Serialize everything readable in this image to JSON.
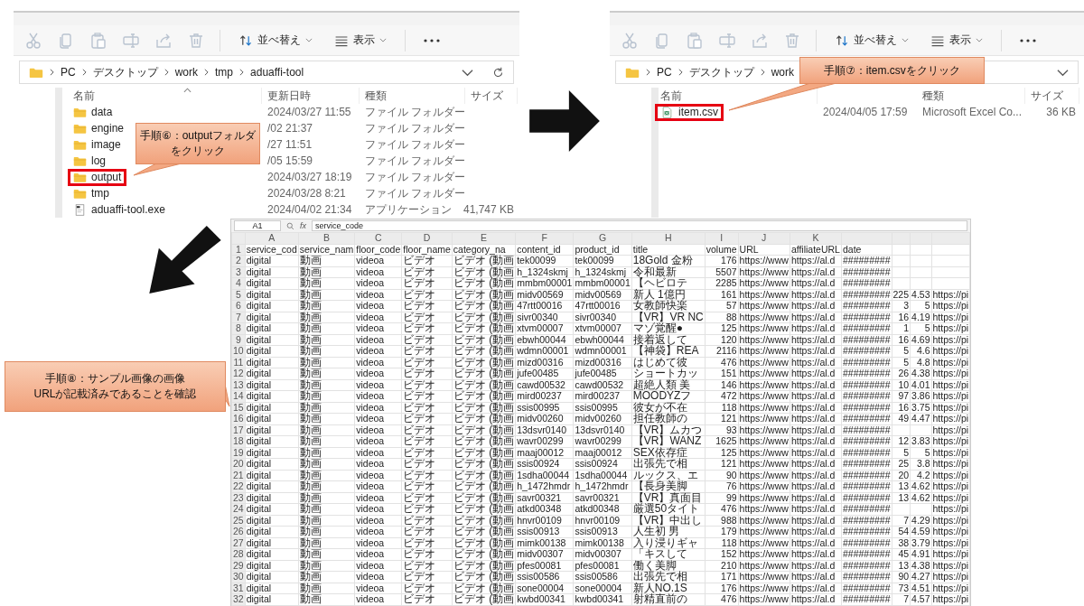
{
  "explorers": [
    {
      "toolbar": {
        "sort": "並べ替え",
        "view": "表示"
      },
      "address": {
        "path": [
          "PC",
          "デスクトップ",
          "work",
          "tmp",
          "aduaffi-tool"
        ],
        "controls": [
          {
            "kind": "dropdown"
          },
          {
            "kind": "refresh"
          }
        ]
      },
      "columns": [
        {
          "kind": "name",
          "label": "名前",
          "sorted": true
        },
        {
          "kind": "modified",
          "label": "更新日時",
          "sorted": false
        },
        {
          "kind": "type",
          "label": "種類",
          "sorted": false
        },
        {
          "kind": "size",
          "label": "サイズ",
          "sorted": false
        }
      ],
      "files": [
        {
          "kind": "folder",
          "name": "data",
          "modified": "2024/03/27 11:55",
          "type": "ファイル フォルダー",
          "highlighted": false
        },
        {
          "kind": "folder",
          "name": "engine",
          "modified": "/02 21:37",
          "type": "ファイル フォルダー",
          "highlighted": false
        },
        {
          "kind": "folder",
          "name": "image",
          "modified": "/27 11:51",
          "type": "ファイル フォルダー",
          "highlighted": false
        },
        {
          "kind": "folder",
          "name": "log",
          "modified": "/05 15:59",
          "type": "ファイル フォルダー",
          "highlighted": false
        },
        {
          "kind": "folder",
          "name": "output",
          "modified": "2024/03/27 18:19",
          "type": "ファイル フォルダー",
          "highlighted": true
        },
        {
          "kind": "folder",
          "name": "tmp",
          "modified": "2024/03/28 8:21",
          "type": "ファイル フォルダー",
          "highlighted": false
        },
        {
          "kind": "app",
          "name": "aduaffi-tool.exe",
          "modified": "2024/04/02 21:34",
          "type": "アプリケーション",
          "size": "41,747 KB",
          "highlighted": false
        }
      ]
    },
    {
      "toolbar": {
        "sort": "並べ替え",
        "view": "表示"
      },
      "address": {
        "path": [
          "PC",
          "デスクトップ",
          "work"
        ],
        "controls": [
          {
            "kind": "dropdown"
          }
        ]
      },
      "columns": [
        {
          "kind": "name",
          "label": "名前",
          "sorted": false
        },
        {
          "kind": "type",
          "label": "種類",
          "sorted": false
        },
        {
          "kind": "size",
          "label": "サイズ",
          "sorted": false
        }
      ],
      "files": [
        {
          "kind": "csv",
          "name": "item.csv",
          "modified": "2024/04/05 17:59",
          "type": "Microsoft Excel Co...",
          "size": "36 KB",
          "highlighted": true
        }
      ]
    }
  ],
  "callouts": [
    {
      "lines": [
        "手順⑥：outputフォルダ",
        "をクリック"
      ]
    },
    {
      "lines": [
        "手順⑦：item.csvをクリック"
      ]
    },
    {
      "lines": [
        "手順⑧：サンプル画像の画像",
        "URLが記載済みであることを確認"
      ]
    }
  ],
  "spreadsheet": {
    "name_box": "A1",
    "fx": "fx",
    "formula": "service_code",
    "column_letters": [
      "A",
      "B",
      "C",
      "D",
      "E",
      "F",
      "G",
      "H",
      "I",
      "J",
      "K"
    ],
    "rows": [
      {
        "number": "1",
        "cells": [
          "service_cod",
          "service_nam",
          "floor_code",
          "floor_name",
          "category_na",
          "content_id",
          "product_id",
          "title",
          "volume",
          "URL",
          "affiliateURL",
          "date",
          null,
          null,
          null
        ]
      },
      {
        "number": "2",
        "cells": [
          "digital",
          "動画",
          "videoa",
          "ビデオ",
          "ビデオ (動画",
          "tek00099",
          "tek00099",
          "18Gold 金粉",
          "176",
          "https://www",
          "https://al.d",
          "#########",
          null,
          null,
          null
        ]
      },
      {
        "number": "3",
        "cells": [
          "digital",
          "動画",
          "videoa",
          "ビデオ",
          "ビデオ (動画",
          "h_1324skmj",
          "h_1324skmj",
          "令和最新",
          "5507",
          "https://www",
          "https://al.d",
          "#########",
          null,
          null,
          null
        ]
      },
      {
        "number": "4",
        "cells": [
          "digital",
          "動画",
          "videoa",
          "ビデオ",
          "ビデオ (動画",
          "mmbm00001",
          "mmbm00001",
          "【ヘビロテ",
          "2285",
          "https://www",
          "https://al.d",
          "#########",
          null,
          null,
          null
        ]
      },
      {
        "number": "5",
        "cells": [
          "digital",
          "動画",
          "videoa",
          "ビデオ",
          "ビデオ (動画",
          "midv00569",
          "midv00569",
          "新人 1億円",
          "161",
          "https://www",
          "https://al.d",
          "#########",
          "225",
          "4.53",
          "https://pi"
        ]
      },
      {
        "number": "6",
        "cells": [
          "digital",
          "動画",
          "videoa",
          "ビデオ",
          "ビデオ (動画",
          "47rtt00016",
          "47rtt00016",
          "女教師快楽",
          "57",
          "https://www",
          "https://al.d",
          "#########",
          "3",
          "5",
          "https://pi"
        ]
      },
      {
        "number": "7",
        "cells": [
          "digital",
          "動画",
          "videoa",
          "ビデオ",
          "ビデオ (動画",
          "sivr00340",
          "sivr00340",
          "【VR】VR NC",
          "88",
          "https://www",
          "https://al.d",
          "#########",
          "16",
          "4.19",
          "https://pi"
        ]
      },
      {
        "number": "8",
        "cells": [
          "digital",
          "動画",
          "videoa",
          "ビデオ",
          "ビデオ (動画",
          "xtvm00007",
          "xtvm00007",
          "マゾ覚醒●",
          "125",
          "https://www",
          "https://al.d",
          "#########",
          "1",
          "5",
          "https://pi"
        ]
      },
      {
        "number": "9",
        "cells": [
          "digital",
          "動画",
          "videoa",
          "ビデオ",
          "ビデオ (動画",
          "ebwh00044",
          "ebwh00044",
          "接着返して",
          "120",
          "https://www",
          "https://al.d",
          "#########",
          "16",
          "4.69",
          "https://pi"
        ]
      },
      {
        "number": "10",
        "cells": [
          "digital",
          "動画",
          "videoa",
          "ビデオ",
          "ビデオ (動画",
          "wdmn00001",
          "wdmn00001",
          "【神袋】REA",
          "2116",
          "https://www",
          "https://al.d",
          "#########",
          "5",
          "4.6",
          "https://pi"
        ]
      },
      {
        "number": "11",
        "cells": [
          "digital",
          "動画",
          "videoa",
          "ビデオ",
          "ビデオ (動画",
          "mizd00316",
          "mizd00316",
          "はじめて彼",
          "476",
          "https://www",
          "https://al.d",
          "#########",
          "5",
          "4.8",
          "https://pi"
        ]
      },
      {
        "number": "12",
        "cells": [
          "digital",
          "動画",
          "videoa",
          "ビデオ",
          "ビデオ (動画",
          "jufe00485",
          "jufe00485",
          "ショートカッ",
          "151",
          "https://www",
          "https://al.d",
          "#########",
          "26",
          "4.38",
          "https://pi"
        ]
      },
      {
        "number": "13",
        "cells": [
          "digital",
          "動画",
          "videoa",
          "ビデオ",
          "ビデオ (動画",
          "cawd00532",
          "cawd00532",
          "超絶人類 美",
          "146",
          "https://www",
          "https://al.d",
          "#########",
          "10",
          "4.01",
          "https://pi"
        ]
      },
      {
        "number": "14",
        "cells": [
          "digital",
          "動画",
          "videoa",
          "ビデオ",
          "ビデオ (動画",
          "mird00237",
          "mird00237",
          "MOODYZフ",
          "472",
          "https://www",
          "https://al.d",
          "#########",
          "97",
          "3.86",
          "https://pi"
        ]
      },
      {
        "number": "15",
        "cells": [
          "digital",
          "動画",
          "videoa",
          "ビデオ",
          "ビデオ (動画",
          "ssis00995",
          "ssis00995",
          "彼女が不在",
          "118",
          "https://www",
          "https://al.d",
          "#########",
          "16",
          "3.75",
          "https://pi"
        ]
      },
      {
        "number": "16",
        "cells": [
          "digital",
          "動画",
          "videoa",
          "ビデオ",
          "ビデオ (動画",
          "midv00260",
          "midv00260",
          "担任教師の",
          "121",
          "https://www",
          "https://al.d",
          "#########",
          "49",
          "4.47",
          "https://pi"
        ]
      },
      {
        "number": "17",
        "cells": [
          "digital",
          "動画",
          "videoa",
          "ビデオ",
          "ビデオ (動画",
          "13dsvr0140",
          "13dsvr0140",
          "【VR】ムカつ",
          "93",
          "https://www",
          "https://al.d",
          "#########",
          null,
          null,
          "https://pi"
        ]
      },
      {
        "number": "18",
        "cells": [
          "digital",
          "動画",
          "videoa",
          "ビデオ",
          "ビデオ (動画",
          "wavr00299",
          "wavr00299",
          "【VR】WANZ",
          "1625",
          "https://www",
          "https://al.d",
          "#########",
          "12",
          "3.83",
          "https://pi"
        ]
      },
      {
        "number": "19",
        "cells": [
          "digital",
          "動画",
          "videoa",
          "ビデオ",
          "ビデオ (動画",
          "maaj00012",
          "maaj00012",
          "SEX依存症",
          "125",
          "https://www",
          "https://al.d",
          "#########",
          "5",
          "5",
          "https://pi"
        ]
      },
      {
        "number": "20",
        "cells": [
          "digital",
          "動画",
          "videoa",
          "ビデオ",
          "ビデオ (動画",
          "ssis00924",
          "ssis00924",
          "出張先で相",
          "121",
          "https://www",
          "https://al.d",
          "#########",
          "25",
          "3.8",
          "https://pi"
        ]
      },
      {
        "number": "21",
        "cells": [
          "digital",
          "動画",
          "videoa",
          "ビデオ",
          "ビデオ (動画",
          "1sdha00044",
          "1sdha00044",
          "ルックス、エ",
          "90",
          "https://www",
          "https://al.d",
          "#########",
          "20",
          "4.2",
          "https://pi"
        ]
      },
      {
        "number": "22",
        "cells": [
          "digital",
          "動画",
          "videoa",
          "ビデオ",
          "ビデオ (動画",
          "h_1472hmdr",
          "h_1472hmdr",
          "【長身美脚",
          "76",
          "https://www",
          "https://al.d",
          "#########",
          "13",
          "4.62",
          "https://pi"
        ]
      },
      {
        "number": "23",
        "cells": [
          "digital",
          "動画",
          "videoa",
          "ビデオ",
          "ビデオ (動画",
          "savr00321",
          "savr00321",
          "【VR】真面目",
          "99",
          "https://www",
          "https://al.d",
          "#########",
          "13",
          "4.62",
          "https://pi"
        ]
      },
      {
        "number": "24",
        "cells": [
          "digital",
          "動画",
          "videoa",
          "ビデオ",
          "ビデオ (動画",
          "atkd00348",
          "atkd00348",
          "厳選50タイト",
          "476",
          "https://www",
          "https://al.d",
          "#########",
          null,
          null,
          "https://pi"
        ]
      },
      {
        "number": "25",
        "cells": [
          "digital",
          "動画",
          "videoa",
          "ビデオ",
          "ビデオ (動画",
          "hnvr00109",
          "hnvr00109",
          "【VR】中出し",
          "988",
          "https://www",
          "https://al.d",
          "#########",
          "7",
          "4.29",
          "https://pi"
        ]
      },
      {
        "number": "26",
        "cells": [
          "digital",
          "動画",
          "videoa",
          "ビデオ",
          "ビデオ (動画",
          "ssis00913",
          "ssis00913",
          "人生初 男",
          "179",
          "https://www",
          "https://al.d",
          "#########",
          "54",
          "4.59",
          "https://pi"
        ]
      },
      {
        "number": "27",
        "cells": [
          "digital",
          "動画",
          "videoa",
          "ビデオ",
          "ビデオ (動画",
          "mimk00138",
          "mimk00138",
          "入り浸りギャ",
          "118",
          "https://www",
          "https://al.d",
          "#########",
          "38",
          "3.79",
          "https://pi"
        ]
      },
      {
        "number": "28",
        "cells": [
          "digital",
          "動画",
          "videoa",
          "ビデオ",
          "ビデオ (動画",
          "midv00307",
          "midv00307",
          "「キスして",
          "152",
          "https://www",
          "https://al.d",
          "#########",
          "45",
          "4.91",
          "https://pi"
        ]
      },
      {
        "number": "29",
        "cells": [
          "digital",
          "動画",
          "videoa",
          "ビデオ",
          "ビデオ (動画",
          "pfes00081",
          "pfes00081",
          "働く美脚",
          "210",
          "https://www",
          "https://al.d",
          "#########",
          "13",
          "4.38",
          "https://pi"
        ]
      },
      {
        "number": "30",
        "cells": [
          "digital",
          "動画",
          "videoa",
          "ビデオ",
          "ビデオ (動画",
          "ssis00586",
          "ssis00586",
          "出張先で相",
          "171",
          "https://www",
          "https://al.d",
          "#########",
          "90",
          "4.27",
          "https://pi"
        ]
      },
      {
        "number": "31",
        "cells": [
          "digital",
          "動画",
          "videoa",
          "ビデオ",
          "ビデオ (動画",
          "sone00004",
          "sone00004",
          "新人NO.1S",
          "176",
          "https://www",
          "https://al.d",
          "#########",
          "73",
          "4.51",
          "https://pi"
        ]
      },
      {
        "number": "32",
        "cells": [
          "digital",
          "動画",
          "videoa",
          "ビデオ",
          "ビデオ (動画",
          "kwbd00341",
          "kwbd00341",
          "射精直前の",
          "476",
          "https://www",
          "https://al.d",
          "#########",
          "7",
          "4.57",
          "https://pi"
        ]
      }
    ]
  }
}
